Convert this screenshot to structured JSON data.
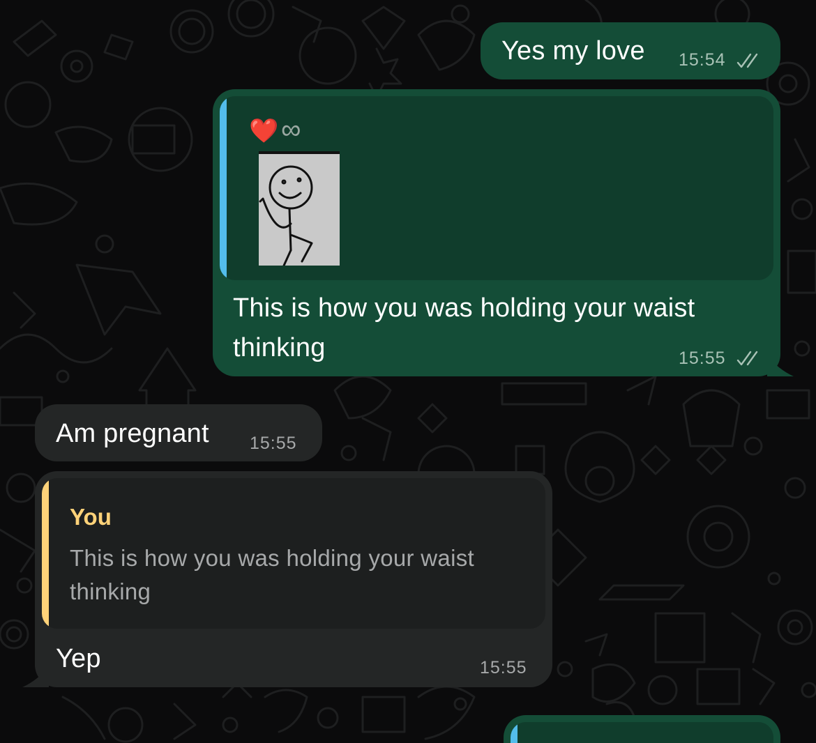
{
  "messages": [
    {
      "direction": "outgoing",
      "text": "Yes my love",
      "time": "15:54",
      "status": "read"
    },
    {
      "direction": "outgoing",
      "quoted": {
        "emoji": "❤️",
        "symbol": "∞",
        "image": "stick-figure-sticker"
      },
      "text_lines": [
        "This is how you was holding your waist",
        "thinking"
      ],
      "time": "15:55",
      "status": "read"
    },
    {
      "direction": "incoming",
      "text": "Am pregnant",
      "time": "15:55"
    },
    {
      "direction": "incoming",
      "quoted": {
        "author": "You",
        "text_lines": [
          "This is how you was holding your waist",
          "thinking"
        ]
      },
      "text": "Yep",
      "time": "15:55"
    },
    {
      "direction": "outgoing",
      "partial": true
    }
  ],
  "colors": {
    "background": "#0b0b0c",
    "outgoing_bubble": "#144d37",
    "outgoing_quote": "#103d2c",
    "incoming_bubble": "#242626",
    "incoming_quote": "#1d1f1f",
    "outgoing_quote_bar": "#53bdeb",
    "incoming_quote_bar": "#ffd279",
    "quote_author": "#ffd279",
    "read_ticks": "#a9c2b6"
  }
}
